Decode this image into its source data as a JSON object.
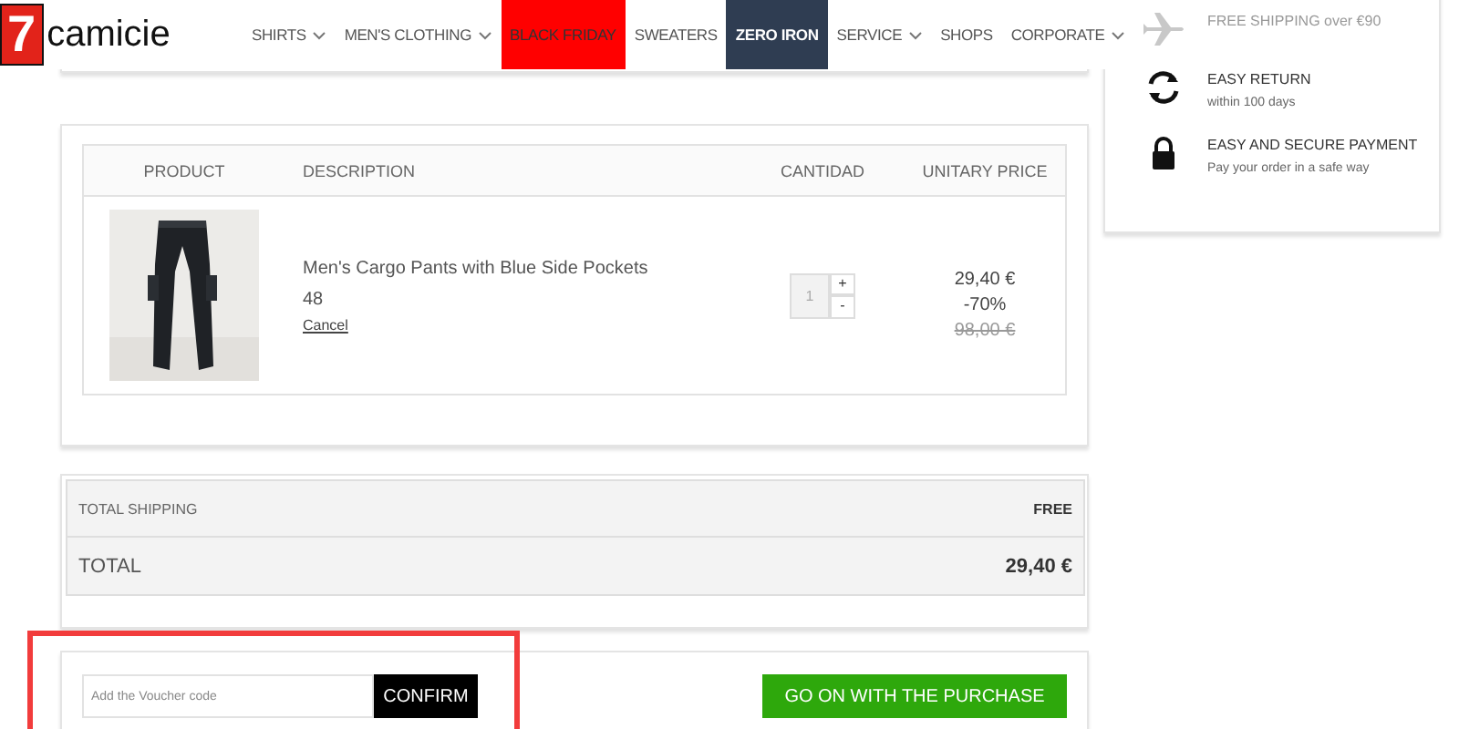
{
  "header": {
    "logo_number": "7",
    "logo_text": "camicie",
    "nav": [
      {
        "label": "SHIRTS",
        "kind": "plain",
        "dropdown": true
      },
      {
        "label": "MEN'S CLOTHING",
        "kind": "plain",
        "dropdown": true
      },
      {
        "label": "BLACK FRIDAY",
        "kind": "red",
        "dropdown": false
      },
      {
        "label": "SWEATERS",
        "kind": "plain",
        "dropdown": false
      },
      {
        "label": "ZERO IRON",
        "kind": "dark",
        "dropdown": false
      },
      {
        "label": "SERVICE",
        "kind": "plain",
        "dropdown": true
      },
      {
        "label": "SHOPS",
        "kind": "plain",
        "dropdown": false
      },
      {
        "label": "CORPORATE",
        "kind": "plain",
        "dropdown": true
      }
    ]
  },
  "cart_table": {
    "columns": [
      "PRODUCT",
      "DESCRIPTION",
      "CANTIDAD",
      "UNITARY PRICE"
    ],
    "rows": [
      {
        "name": "Men's Cargo Pants with Blue Side Pockets",
        "size": "48",
        "cancel": "Cancel",
        "quantity": "1",
        "plus": "+",
        "minus": "-",
        "price": "29,40 €",
        "discount": "-70%",
        "old_price": "98,00 €"
      }
    ]
  },
  "totals": [
    {
      "kind": "shipping",
      "label": "TOTAL SHIPPING",
      "value": "FREE"
    },
    {
      "kind": "total",
      "label": "TOTAL",
      "value": "29,40 €"
    }
  ],
  "voucher": {
    "placeholder": "Add the Voucher code",
    "button": "CONFIRM",
    "highlighted": true
  },
  "purchase_button": "GO ON WITH THE PURCHASE",
  "benefits": [
    {
      "kind": "shipping",
      "title": "FREE SHIPPING over €90"
    },
    {
      "kind": "return",
      "title": "EASY RETURN",
      "note": "within 100 days"
    },
    {
      "kind": "payment",
      "title": "EASY AND SECURE PAYMENT",
      "note": "Pay your order in a safe way"
    }
  ]
}
